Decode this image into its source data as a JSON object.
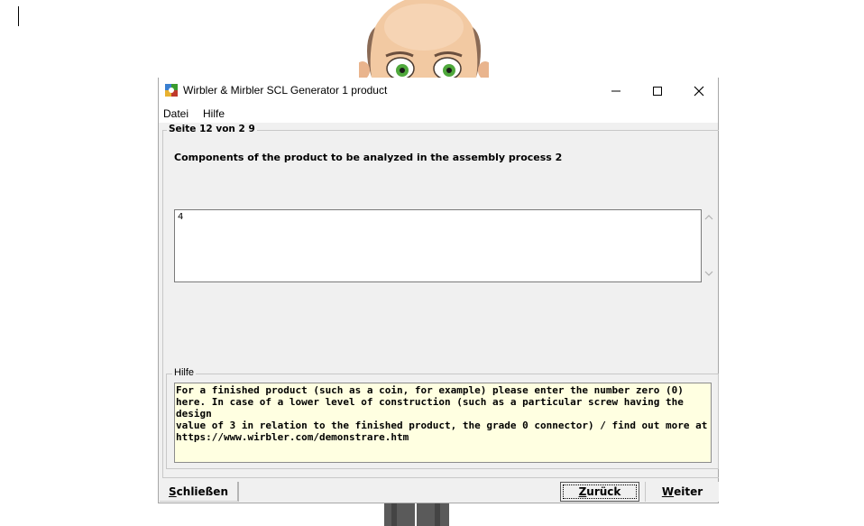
{
  "window": {
    "title": "Wirbler & Mirbler SCL Generator 1 product",
    "icon": "app-logo-icon"
  },
  "titlebar_buttons": {
    "minimize_icon": "minimize-icon",
    "maximize_icon": "maximize-icon",
    "close_icon": "close-icon"
  },
  "menu": {
    "items": [
      {
        "label": "Datei"
      },
      {
        "label": "Hilfe"
      }
    ]
  },
  "page": {
    "group_label": "Seite 12 von 2 9",
    "question": "Components of the product to be analyzed in the assembly process 2",
    "answer_value": "4"
  },
  "help": {
    "group_label": "Hilfe",
    "text": "For a finished product (such as a coin, for example) please enter the number zero (0)\nhere. In case of a lower level of construction (such as a particular screw having the design\nvalue of 3 in relation to the finished product, the grade 0 connector) / find out more at\nhttps://www.wirbler.com/demonstrare.htm"
  },
  "buttons": {
    "close_first": "S",
    "close_rest": "chließen",
    "back_first": "Z",
    "back_rest": "urück",
    "next_first": "W",
    "next_rest": "eiter"
  },
  "colors": {
    "window_bg": "#f0f0f0",
    "help_bg": "#ffffe1",
    "accent_green": "#3a9b2e"
  }
}
